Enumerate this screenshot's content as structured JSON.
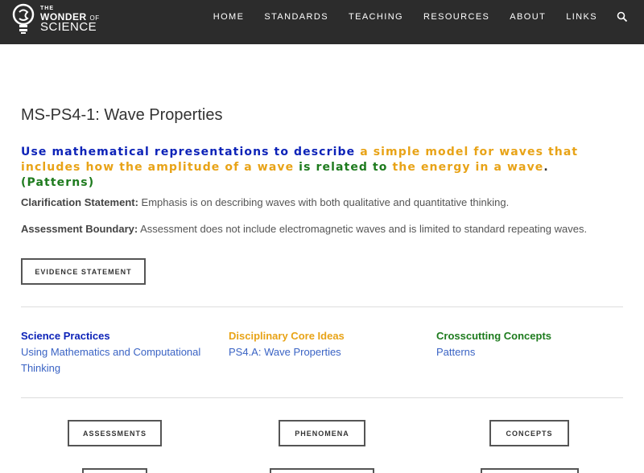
{
  "header": {
    "logo": {
      "the": "THE",
      "wonder": "WONDER",
      "of": "OF",
      "science": "SCIENCE"
    },
    "nav": [
      {
        "label": "HOME"
      },
      {
        "label": "STANDARDS"
      },
      {
        "label": "TEACHING"
      },
      {
        "label": "RESOURCES"
      },
      {
        "label": "ABOUT"
      },
      {
        "label": "LINKS"
      }
    ],
    "search_icon": "search-icon"
  },
  "page": {
    "title": "MS-PS4-1: Wave Properties",
    "performance_expectation": {
      "part1": "Use mathematical representations to describe",
      "part2": "a simple model for waves that includes how the amplitude of a wave",
      "part3": "is related to",
      "part4": "the energy in a wave",
      "part5": ".",
      "part6": "(Patterns)"
    },
    "clarification_label": "Clarification Statement:",
    "clarification_text": " Emphasis is on describing waves with both qualitative and quantitative thinking.",
    "assessment_label": "Assessment Boundary:",
    "assessment_text": " Assessment does not include electromagnetic waves and is limited to standard repeating waves.",
    "evidence_button": "EVIDENCE STATEMENT"
  },
  "dimensions": [
    {
      "heading": "Science Practices",
      "link": "Using Mathematics and Computational Thinking",
      "color": "#0d23b8"
    },
    {
      "heading": "Disciplinary Core Ideas",
      "link": "PS4.A: Wave Properties",
      "color": "#e8a317"
    },
    {
      "heading": "Crosscutting Concepts",
      "link": "Patterns",
      "color": "#1e7b1e"
    }
  ],
  "bottom_buttons": {
    "assessments": "ASSESSMENTS",
    "phenomena": "PHENOMENA",
    "concepts": "CONCEPTS"
  },
  "colors": {
    "header_bg": "#2c2c2c",
    "blue": "#0d23b8",
    "orange": "#e8a317",
    "green": "#1e7b1e",
    "link": "#3a63c4"
  }
}
